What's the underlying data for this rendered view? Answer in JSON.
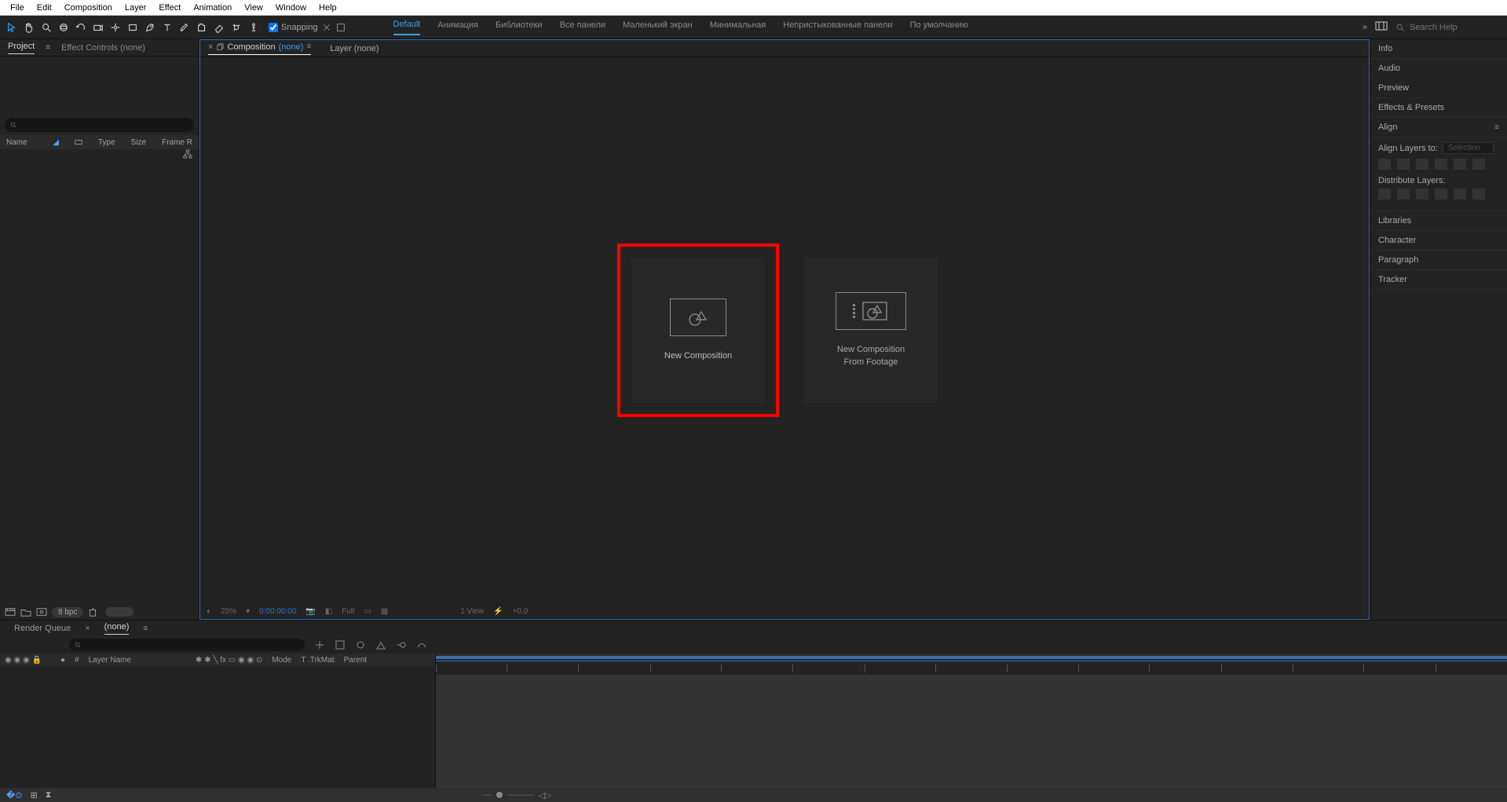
{
  "menu": {
    "file": "File",
    "edit": "Edit",
    "composition": "Composition",
    "layer": "Layer",
    "effect": "Effect",
    "animation": "Animation",
    "view": "View",
    "window": "Window",
    "help": "Help"
  },
  "toolbar": {
    "snapping_label": "Snapping",
    "workspaces": [
      "Default",
      "Анимация",
      "Библиотеки",
      "Все панели",
      "Маленький экран",
      "Минимальная",
      "Непристыкованные панели",
      "По умолчанию"
    ],
    "search_placeholder": "Search Help"
  },
  "left_panel": {
    "tab_project": "Project",
    "tab_effect_controls": "Effect Controls (none)",
    "cols": {
      "name": "Name",
      "type": "Type",
      "size": "Size",
      "frame": "Frame R"
    },
    "bpc": "8 bpc"
  },
  "center": {
    "tab_composition_label": "Composition",
    "tab_composition_none": "(none)",
    "tab_layer": "Layer (none)",
    "card1": "New Composition",
    "card2_line1": "New Composition",
    "card2_line2": "From Footage",
    "footer": {
      "zoom": "25%",
      "timecode": "0:00:00:00",
      "res": "Full",
      "views": "1 View",
      "exposure": "+0,0"
    }
  },
  "right": {
    "info": "Info",
    "audio": "Audio",
    "preview": "Preview",
    "effects": "Effects & Presets",
    "align": "Align",
    "align_layers_to": "Align Layers to:",
    "align_sel": "Selection",
    "distribute": "Distribute Layers:",
    "libraries": "Libraries",
    "character": "Character",
    "paragraph": "Paragraph",
    "tracker": "Tracker"
  },
  "timeline": {
    "tab_render": "Render Queue",
    "tab_none": "(none)",
    "cols": {
      "layer_name": "Layer Name",
      "mode": "Mode",
      "trkmat": "T .TrkMat",
      "parent": "Parent"
    }
  }
}
